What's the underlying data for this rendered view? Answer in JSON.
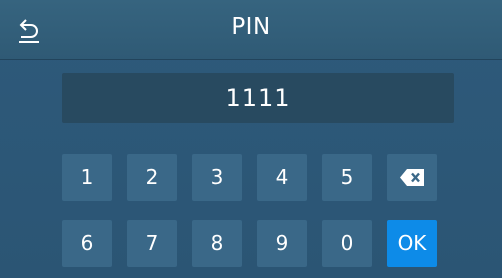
{
  "header": {
    "title": "PIN",
    "back_icon": "undo-arrow-icon"
  },
  "pin": {
    "value": "1111"
  },
  "keypad": {
    "row1": [
      "1",
      "2",
      "3",
      "4",
      "5"
    ],
    "row2": [
      "6",
      "7",
      "8",
      "9",
      "0"
    ],
    "backspace_icon": "backspace-icon",
    "ok_label": "OK"
  },
  "colors": {
    "background": "#2d5878",
    "key": "#3a6888",
    "ok_key": "#0d8be8",
    "display": "#284a60"
  }
}
